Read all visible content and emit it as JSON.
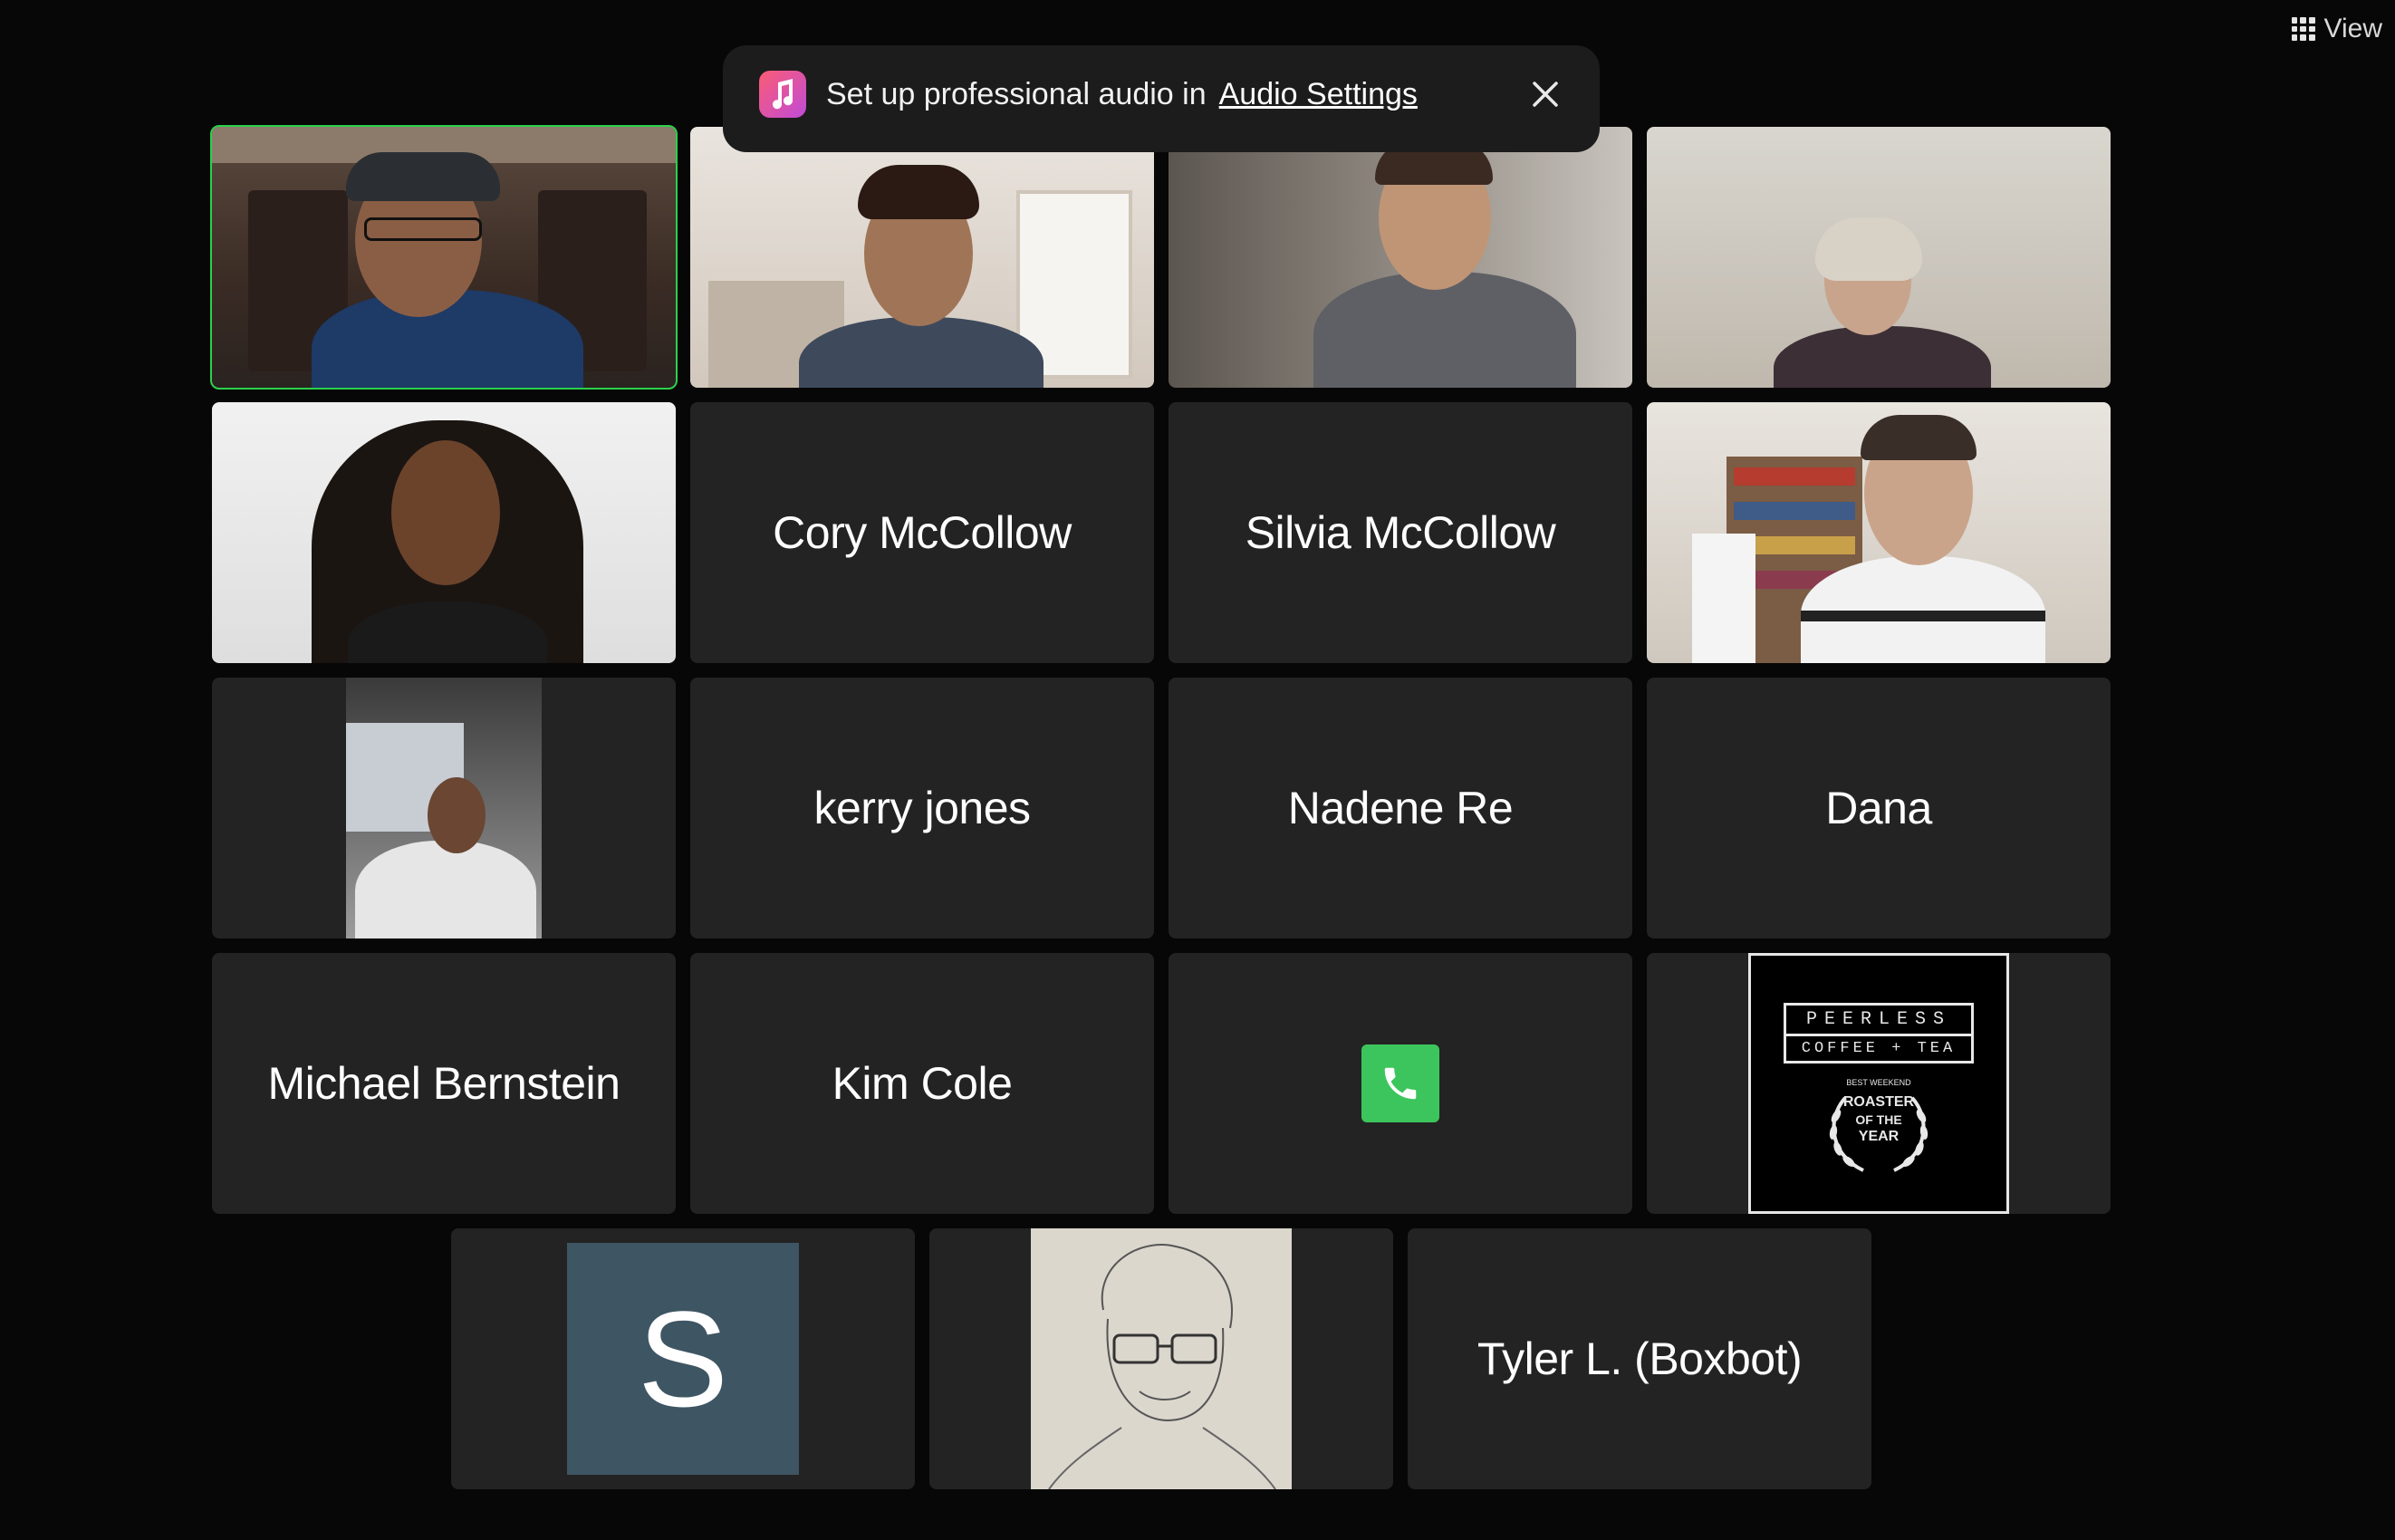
{
  "window": {
    "view_button_label": "View"
  },
  "banner": {
    "message": "Set up professional audio in",
    "link_label": "Audio Settings",
    "icon": "music-note-icon",
    "close_icon": "close-icon"
  },
  "participants": {
    "cory": "Cory McCollow",
    "silvia": "Silvia McCollow",
    "kerry": "kerry jones",
    "nadene": "Nadene Re",
    "dana": "Dana",
    "michael": "Michael Bernstein",
    "kim": "Kim Cole",
    "tyler": "Tyler L. (Boxbot)",
    "s_avatar_initial": "S"
  },
  "logo": {
    "line1": "PEERLESS",
    "line2": "COFFEE + TEA",
    "badge_top": "BEST WEEKEND",
    "badge_line1": "ROASTER",
    "badge_line2": "OF THE",
    "badge_line3": "YEAR"
  },
  "colors": {
    "background": "#070707",
    "tile": "#232323",
    "active_speaker": "#2bd14a",
    "phone_green": "#3cc55c",
    "avatar_s": "#3e5563"
  }
}
